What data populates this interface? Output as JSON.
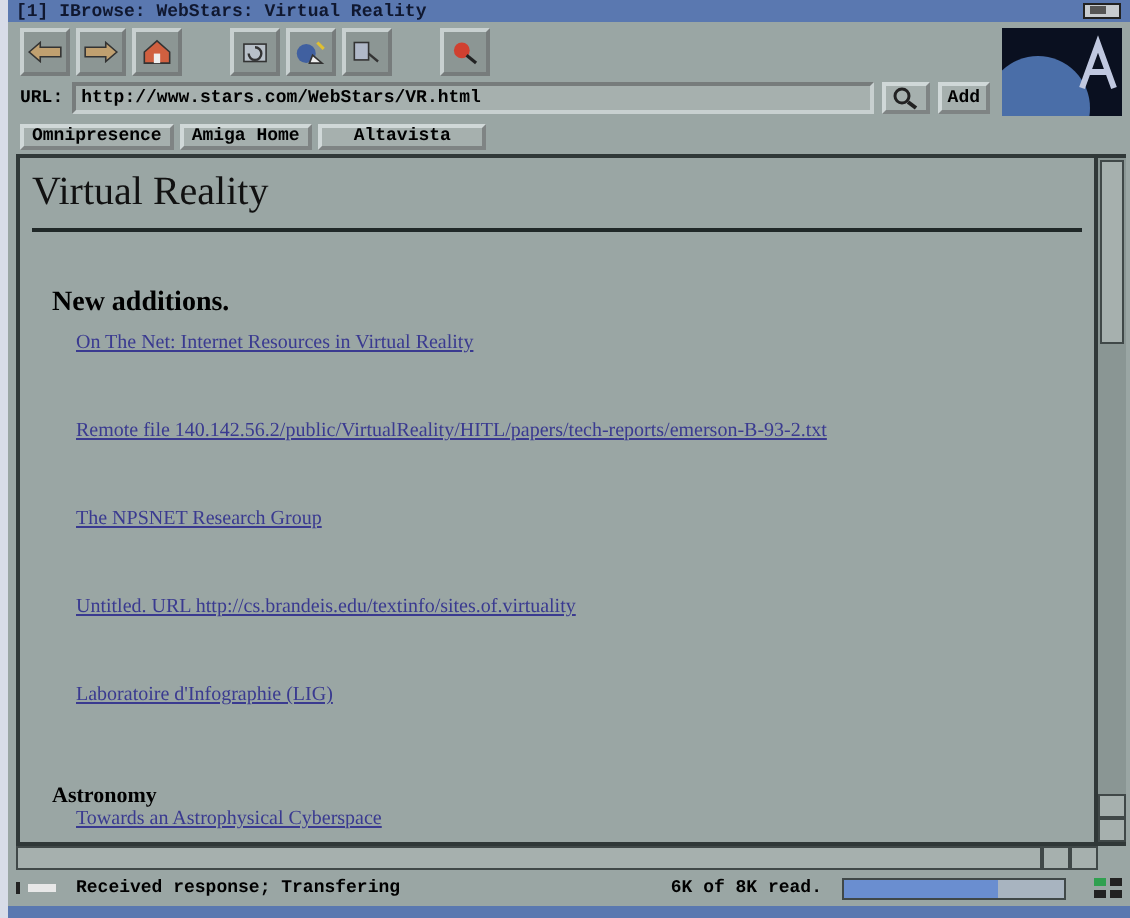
{
  "window": {
    "title": "[1] IBrowse: WebStars: Virtual Reality"
  },
  "toolbar": {
    "buttons": [
      {
        "kind": "back"
      },
      {
        "kind": "forward"
      },
      {
        "kind": "home"
      },
      {
        "kind": "gap"
      },
      {
        "kind": "reload"
      },
      {
        "kind": "images"
      },
      {
        "kind": "source"
      },
      {
        "kind": "gap"
      },
      {
        "kind": "stop"
      }
    ]
  },
  "url": {
    "label": "URL:",
    "value": "http://www.stars.com/WebStars/VR.html",
    "add": "Add"
  },
  "hotlist": [
    "Omnipresence",
    "Amiga Home",
    "Altavista"
  ],
  "page": {
    "title": "Virtual Reality",
    "sections": [
      {
        "heading": "New additions.",
        "links": [
          "On The Net: Internet Resources in Virtual Reality",
          "Remote file 140.142.56.2/public/VirtualReality/HITL/papers/tech-reports/emerson-B-93-2.txt",
          "The NPSNET Research Group",
          "Untitled. URL http://cs.brandeis.edu/textinfo/sites.of.virtuality",
          "Laboratoire d'Infographie (LIG)"
        ]
      },
      {
        "heading": "Astronomy",
        "links": [
          "Towards an Astrophysical Cyberspace"
        ]
      }
    ]
  },
  "status_bar": {
    "message": "Received response; Transfering",
    "progress_text": "6K of 8K read.",
    "level": 0.7
  }
}
